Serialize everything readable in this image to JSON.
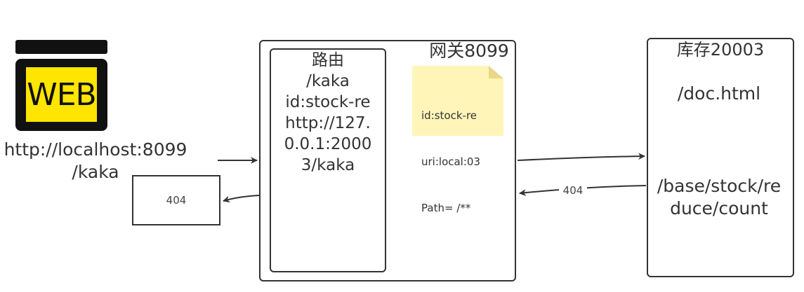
{
  "client": {
    "icon_label": "WEB",
    "url_line1": "http://localhost:8099",
    "url_line2": "/kaka"
  },
  "response_box": {
    "text": "404"
  },
  "gateway": {
    "title": "网关8099",
    "route": {
      "line1": "路由",
      "line2": "/kaka",
      "line3": "id:stock-re",
      "line4": "http://127.",
      "line5": "0.0.1:2000",
      "line6": "3/kaka"
    },
    "note": {
      "line1": "id:stock-re",
      "line2": "uri:local:03",
      "line3": "Path= /**"
    }
  },
  "stock": {
    "title": "库存20003",
    "path1": "/doc.html",
    "path2_line1": "/base/stock/re",
    "path2_line2": "duce/count"
  },
  "edges": {
    "return_label": "404"
  },
  "colors": {
    "icon_yellow": "#ffe500",
    "note_yellow": "#fff5b8",
    "stroke": "#333333"
  }
}
